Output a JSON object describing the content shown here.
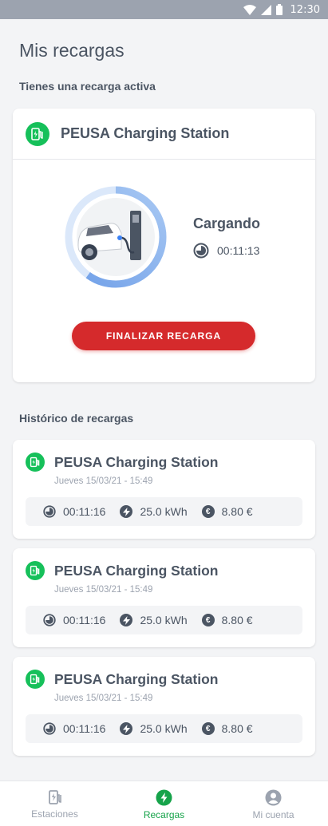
{
  "status_bar": {
    "time": "12:30",
    "icons": [
      "wifi-icon",
      "signal-icon",
      "battery-icon"
    ]
  },
  "page_title": "Mis recargas",
  "active_section": {
    "label": "Tienes una recarga activa",
    "station": "PEUSA Charging Station",
    "status": "Cargando",
    "elapsed": "00:11:13",
    "progress_fraction": 0.6,
    "finish_button": "FINALIZAR RECARGA"
  },
  "history_section": {
    "label": "Histórico de recargas",
    "items": [
      {
        "station": "PEUSA Charging Station",
        "date": "Jueves 15/03/21 - 15:49",
        "duration": "00:11:16",
        "energy": "25.0 kWh",
        "cost": "8.80 €"
      },
      {
        "station": "PEUSA Charging Station",
        "date": "Jueves 15/03/21 - 15:49",
        "duration": "00:11:16",
        "energy": "25.0 kWh",
        "cost": "8.80 €"
      },
      {
        "station": "PEUSA Charging Station",
        "date": "Jueves 15/03/21 - 15:49",
        "duration": "00:11:16",
        "energy": "25.0 kWh",
        "cost": "8.80 €"
      }
    ]
  },
  "bottom_nav": {
    "items": [
      {
        "label": "Estaciones",
        "icon": "charging-station-icon",
        "active": false
      },
      {
        "label": "Recargas",
        "icon": "lightning-icon",
        "active": true
      },
      {
        "label": "Mi cuenta",
        "icon": "user-icon",
        "active": false
      }
    ]
  },
  "colors": {
    "accent_green": "#16c05a",
    "danger_red": "#d52a2c",
    "progress_blue": "#5b8fe0",
    "text": "#4b5563",
    "muted": "#9ca3af"
  }
}
